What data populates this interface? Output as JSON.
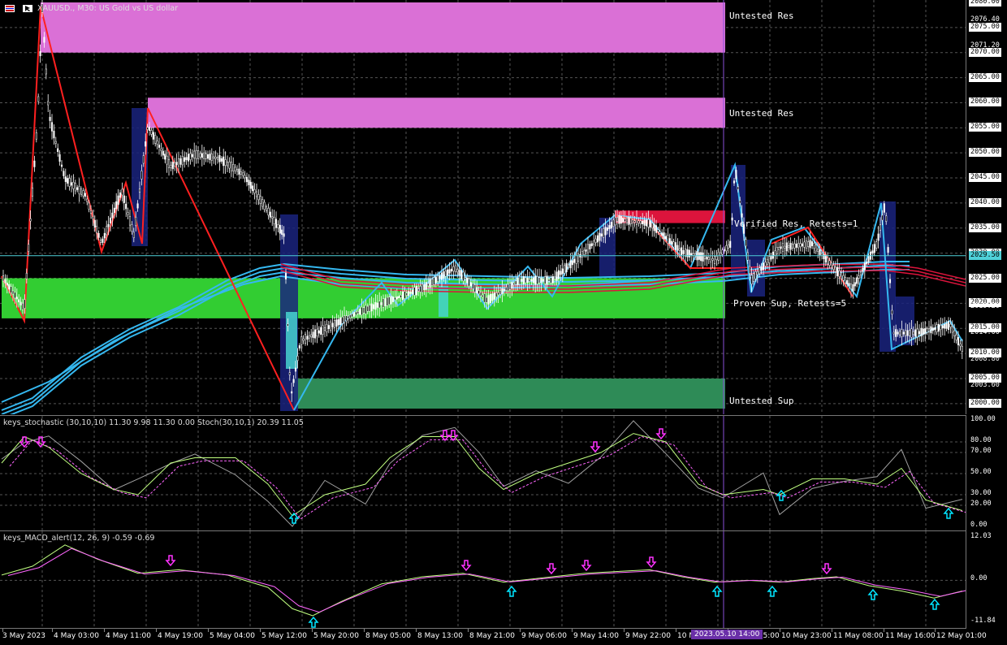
{
  "symbol_title": "XAUUSD., M30:  US Gold vs US dollar",
  "toolbar_icons": [
    "chart-flag-icon",
    "cursor-arrow-icon"
  ],
  "colors": {
    "resistance_zone": "#da70d6",
    "verified_res": "#dc143c",
    "support_zone": "#32cd32",
    "untested_sup": "#2e8b57",
    "candle": "#ffffff",
    "ma_blue": "#35b8f0",
    "ma_red": "#dc143c",
    "zigzag": "#ff2020",
    "cursor_line": "#8a4fd8",
    "up_arrow": "#00e5ff",
    "down_arrow": "#ff33ff"
  },
  "zones": [
    {
      "label": "Untested Res",
      "top": 2080.0,
      "bottom": 2070.0
    },
    {
      "label": "Untested Res",
      "top": 2061.0,
      "bottom": 2055.0
    },
    {
      "label": "Verified Res, Retests=1",
      "top": 2038.5,
      "bottom": 2036.0
    },
    {
      "label": "Proven Sup, Retests=5",
      "top": 2025.0,
      "bottom": 2017.0
    },
    {
      "label": "Untested Sup",
      "top": 2005.0,
      "bottom": 1999.0
    }
  ],
  "price_axis": {
    "labels": [
      "2080.00",
      "2076.40",
      "2075.00",
      "2071.20",
      "2070.00",
      "2065.00",
      "2060.00",
      "2055.00",
      "2050.00",
      "2045.00",
      "2040.00",
      "2035.00",
      "2030.00",
      "2025.00",
      "2020.00",
      "2019.20",
      "2015.00",
      "2014.00",
      "2010.00",
      "2008.80",
      "2005.00",
      "2003.60",
      "2000.00"
    ],
    "current_price": "2029.50",
    "current_price_value": 2029.5,
    "highlight_price": "2010.00",
    "min": 1999.0,
    "max": 2080.5
  },
  "stochastic": {
    "title": "keys_stochastic (30,10,10) 11.30 9.98 11.30 0.00 Stoch(30,10,1) 20.39 11.05",
    "axis_labels": [
      "100.00",
      "80.00",
      "70.00",
      "50.00",
      "30.00",
      "20.00",
      "0.00"
    ]
  },
  "macd": {
    "title": "keys_MACD_alert(12, 26, 9) -0.59 -0.69",
    "axis_labels": [
      "12.03",
      "0.00",
      "-11.84"
    ]
  },
  "time_axis": {
    "labels": [
      "3 May 2023",
      "4 May 03:00",
      "4 May 11:00",
      "4 May 19:00",
      "5 May 04:00",
      "5 May 12:00",
      "5 May 20:00",
      "8 May 05:00",
      "8 May 13:00",
      "8 May 21:00",
      "9 May 06:00",
      "9 May 14:00",
      "9 May 22:00",
      "10 M",
      "10 May 15:00",
      "10 May 23:00",
      "11 May 08:00",
      "11 May 16:00",
      "12 May 01:00"
    ],
    "cursor_label": "2023.05.10 14:00"
  }
}
